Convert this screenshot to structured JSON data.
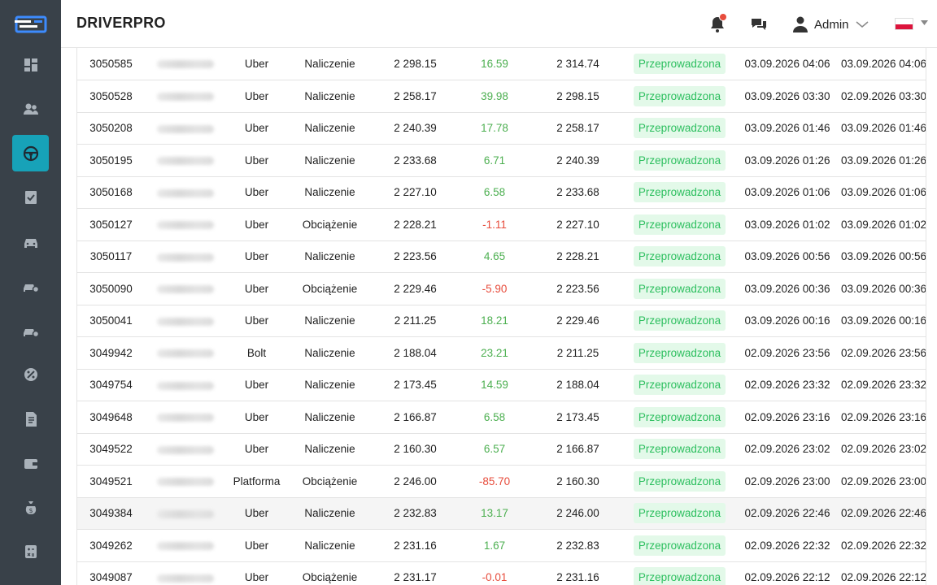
{
  "app": {
    "brand": "DRIVERPRO"
  },
  "header": {
    "user_name": "Admin",
    "language": "pl",
    "notification_dot_color": "#e74c3c"
  },
  "sidebar": {
    "accent_color": "#17a2b8",
    "items": [
      {
        "icon": "dashboard-icon",
        "active": false
      },
      {
        "icon": "users-icon",
        "active": false
      },
      {
        "icon": "steering-wheel-icon",
        "active": true
      },
      {
        "icon": "checklist-icon",
        "active": false
      },
      {
        "icon": "car-icon",
        "active": false
      },
      {
        "icon": "car-settings-icon",
        "active": false
      },
      {
        "icon": "car-settings-alt-icon",
        "active": false
      },
      {
        "icon": "percent-icon",
        "active": false
      },
      {
        "icon": "invoice-icon",
        "active": false
      },
      {
        "icon": "wallet-icon",
        "active": false
      },
      {
        "icon": "money-bag-icon",
        "active": false
      },
      {
        "icon": "calculator-icon",
        "active": false
      }
    ]
  },
  "table": {
    "rows": [
      {
        "id": "3050585",
        "platform": "Uber",
        "type": "Naliczenie",
        "before": "2 298.15",
        "amount": "16.59",
        "sign": "pos",
        "after": "2 314.74",
        "status": "Przeprowadzona",
        "date1": "03.09.2026 04:06",
        "date2": "03.09.2026 04:06"
      },
      {
        "id": "3050528",
        "platform": "Uber",
        "type": "Naliczenie",
        "before": "2 258.17",
        "amount": "39.98",
        "sign": "pos",
        "after": "2 298.15",
        "status": "Przeprowadzona",
        "date1": "03.09.2026 03:30",
        "date2": "02.09.2026 03:30"
      },
      {
        "id": "3050208",
        "platform": "Uber",
        "type": "Naliczenie",
        "before": "2 240.39",
        "amount": "17.78",
        "sign": "pos",
        "after": "2 258.17",
        "status": "Przeprowadzona",
        "date1": "03.09.2026 01:46",
        "date2": "03.09.2026 01:46"
      },
      {
        "id": "3050195",
        "platform": "Uber",
        "type": "Naliczenie",
        "before": "2 233.68",
        "amount": "6.71",
        "sign": "pos",
        "after": "2 240.39",
        "status": "Przeprowadzona",
        "date1": "03.09.2026 01:26",
        "date2": "03.09.2026 01:26"
      },
      {
        "id": "3050168",
        "platform": "Uber",
        "type": "Naliczenie",
        "before": "2 227.10",
        "amount": "6.58",
        "sign": "pos",
        "after": "2 233.68",
        "status": "Przeprowadzona",
        "date1": "03.09.2026 01:06",
        "date2": "03.09.2026 01:06"
      },
      {
        "id": "3050127",
        "platform": "Uber",
        "type": "Obciążenie",
        "before": "2 228.21",
        "amount": "-1.11",
        "sign": "neg",
        "after": "2 227.10",
        "status": "Przeprowadzona",
        "date1": "03.09.2026 01:02",
        "date2": "03.09.2026 01:02"
      },
      {
        "id": "3050117",
        "platform": "Uber",
        "type": "Naliczenie",
        "before": "2 223.56",
        "amount": "4.65",
        "sign": "pos",
        "after": "2 228.21",
        "status": "Przeprowadzona",
        "date1": "03.09.2026 00:56",
        "date2": "03.09.2026 00:56"
      },
      {
        "id": "3050090",
        "platform": "Uber",
        "type": "Obciążenie",
        "before": "2 229.46",
        "amount": "-5.90",
        "sign": "neg",
        "after": "2 223.56",
        "status": "Przeprowadzona",
        "date1": "03.09.2026 00:36",
        "date2": "03.09.2026 00:36"
      },
      {
        "id": "3050041",
        "platform": "Uber",
        "type": "Naliczenie",
        "before": "2 211.25",
        "amount": "18.21",
        "sign": "pos",
        "after": "2 229.46",
        "status": "Przeprowadzona",
        "date1": "03.09.2026 00:16",
        "date2": "03.09.2026 00:16"
      },
      {
        "id": "3049942",
        "platform": "Bolt",
        "type": "Naliczenie",
        "before": "2 188.04",
        "amount": "23.21",
        "sign": "pos",
        "after": "2 211.25",
        "status": "Przeprowadzona",
        "date1": "02.09.2026 23:56",
        "date2": "02.09.2026 23:56"
      },
      {
        "id": "3049754",
        "platform": "Uber",
        "type": "Naliczenie",
        "before": "2 173.45",
        "amount": "14.59",
        "sign": "pos",
        "after": "2 188.04",
        "status": "Przeprowadzona",
        "date1": "02.09.2026 23:32",
        "date2": "02.09.2026 23:32"
      },
      {
        "id": "3049648",
        "platform": "Uber",
        "type": "Naliczenie",
        "before": "2 166.87",
        "amount": "6.58",
        "sign": "pos",
        "after": "2 173.45",
        "status": "Przeprowadzona",
        "date1": "02.09.2026 23:16",
        "date2": "02.09.2026 23:16"
      },
      {
        "id": "3049522",
        "platform": "Uber",
        "type": "Naliczenie",
        "before": "2 160.30",
        "amount": "6.57",
        "sign": "pos",
        "after": "2 166.87",
        "status": "Przeprowadzona",
        "date1": "02.09.2026 23:02",
        "date2": "02.09.2026 23:02"
      },
      {
        "id": "3049521",
        "platform": "Platforma",
        "type": "Obciążenie",
        "before": "2 246.00",
        "amount": "-85.70",
        "sign": "neg",
        "after": "2 160.30",
        "status": "Przeprowadzona",
        "date1": "02.09.2026 23:00",
        "date2": "02.09.2026 23:00"
      },
      {
        "id": "3049384",
        "platform": "Uber",
        "type": "Naliczenie",
        "before": "2 232.83",
        "amount": "13.17",
        "sign": "pos",
        "after": "2 246.00",
        "status": "Przeprowadzona",
        "date1": "02.09.2026 22:46",
        "date2": "02.09.2026 22:46",
        "highlighted": true
      },
      {
        "id": "3049262",
        "platform": "Uber",
        "type": "Naliczenie",
        "before": "2 231.16",
        "amount": "1.67",
        "sign": "pos",
        "after": "2 232.83",
        "status": "Przeprowadzona",
        "date1": "02.09.2026 22:32",
        "date2": "02.09.2026 22:32"
      },
      {
        "id": "3049087",
        "platform": "Uber",
        "type": "Obciążenie",
        "before": "2 231.17",
        "amount": "-0.01",
        "sign": "neg",
        "after": "2 231.16",
        "status": "Przeprowadzona",
        "date1": "02.09.2026 22:12",
        "date2": "02.09.2026 22:12"
      }
    ]
  }
}
